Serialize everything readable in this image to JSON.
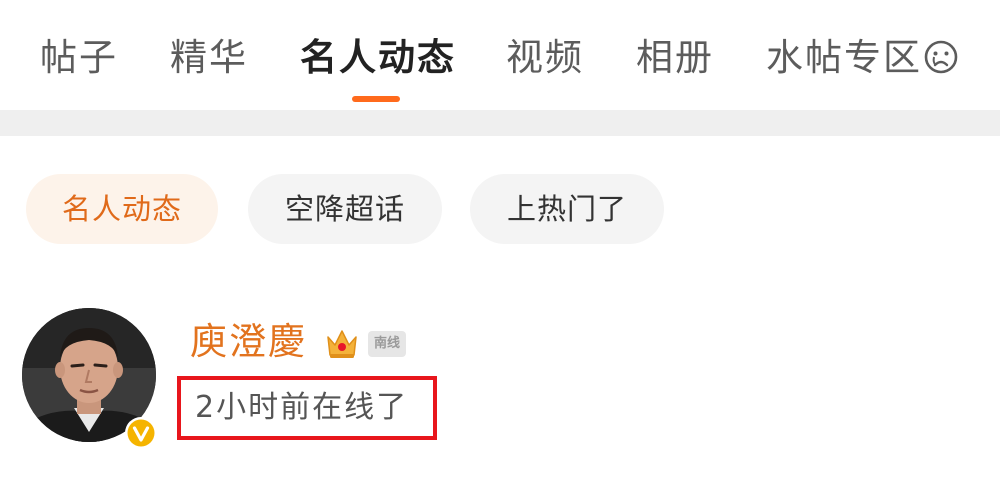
{
  "tabs": [
    {
      "label": "帖子"
    },
    {
      "label": "精华"
    },
    {
      "label": "名人动态"
    },
    {
      "label": "视频"
    },
    {
      "label": "相册"
    },
    {
      "label": "水帖专区"
    }
  ],
  "active_tab": "名人动态",
  "chips": [
    {
      "label": "名人动态"
    },
    {
      "label": "空降超话"
    },
    {
      "label": "上热门了"
    }
  ],
  "post": {
    "author_name": "庾澄慶",
    "level_badge": "南线",
    "online_status": "2小时前在线了"
  },
  "icons": {
    "emoji": "sad-face-emoji-icon",
    "crown": "crown-icon",
    "verified": "verified-v-icon"
  },
  "colors": {
    "accent": "#ff6a1c",
    "author_name": "#e2731e",
    "highlight_box": "#e8161c",
    "verified": "#f5b400"
  }
}
